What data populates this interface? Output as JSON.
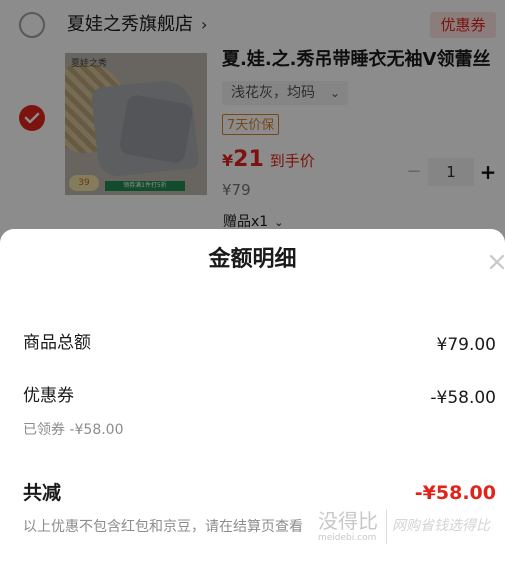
{
  "store": {
    "name": "夏娃之秀旗舰店",
    "chevron": "›",
    "coupon_label": "优惠券"
  },
  "product": {
    "image_brand": "夏娃之秀",
    "image_price": "39",
    "image_banner": "领券满1件打5折",
    "title": "夏.娃.之.秀吊带睡衣无袖V领蕾丝",
    "variant": "浅花灰，均码",
    "return_tag": "7天价保",
    "price_currency": "¥",
    "price_value": "21",
    "price_label": "到手价",
    "original_price": "¥79",
    "gift": "赠品x1",
    "quantity": "1",
    "minus_label": "−",
    "plus_label": "+"
  },
  "sheet": {
    "title": "金额明细",
    "close_label": "×",
    "rows": [
      {
        "label": "商品总额",
        "value": "¥79.00"
      },
      {
        "label": "优惠券",
        "value": "-¥58.00",
        "sub": "已领券 -¥58.00"
      }
    ],
    "total_label": "共减",
    "total_value": "-¥58.00",
    "note": "以上优惠不包含红包和京豆，请在结算页查看"
  },
  "watermark": {
    "text": "没得比",
    "sub": "meidebi.com",
    "right": "网购省钱选得比"
  },
  "colors": {
    "accent": "#e2231a",
    "orange": "#d9822b",
    "muted": "#8c8c8c"
  }
}
